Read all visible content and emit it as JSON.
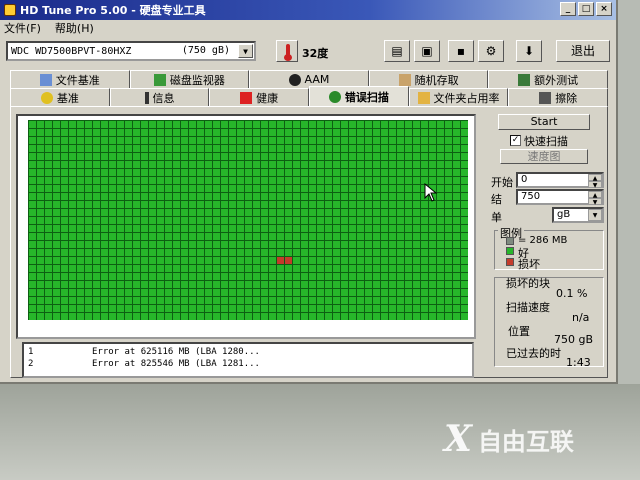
{
  "window": {
    "title": "HD Tune Pro 5.00 - 硬盘专业工具"
  },
  "menu": {
    "items": [
      "文件(F)",
      "帮助(H)"
    ]
  },
  "toolbar": {
    "drive_name": "WDC WD7500BPVT-80HXZ",
    "drive_capacity": "(750 gB)",
    "temperature": "32度",
    "exit_label": "退出",
    "icons": [
      "copy-info-icon",
      "copy-screenshot-icon",
      "save-icon",
      "options-icon",
      "down-arrow-icon"
    ]
  },
  "tabs_row1": [
    {
      "label": "文件基准",
      "icon": "file-benchmark-icon"
    },
    {
      "label": "磁盘监视器",
      "icon": "disk-monitor-icon"
    },
    {
      "label": "AAM",
      "icon": "aam-icon"
    },
    {
      "label": "随机存取",
      "icon": "random-access-icon"
    },
    {
      "label": "额外测试",
      "icon": "extra-tests-icon"
    }
  ],
  "tabs_row2": [
    {
      "label": "基准",
      "icon": "benchmark-icon",
      "active": false
    },
    {
      "label": "信息",
      "icon": "info-icon",
      "active": false
    },
    {
      "label": "健康",
      "icon": "health-icon",
      "active": false
    },
    {
      "label": "错误扫描",
      "icon": "error-scan-icon",
      "active": true
    },
    {
      "label": "文件夹占用率",
      "icon": "folder-usage-icon",
      "active": false
    },
    {
      "label": "擦除",
      "icon": "erase-icon",
      "active": false
    }
  ],
  "controls": {
    "start_label": "Start",
    "quick_scan_label": "快速扫描",
    "quick_scan_checked": true,
    "speed_map_label": "速度图",
    "start_field_label": "开始",
    "start_value": "0",
    "end_field_label": "结",
    "end_value": "750",
    "unit_label": "单",
    "unit_value": "gB"
  },
  "legend": {
    "title": "图例",
    "block_size": "= 286 MB",
    "good_label": "好",
    "bad_label": "损坏"
  },
  "stats": {
    "damaged_label": "损坏的块",
    "damaged_value": "0.1 %",
    "speed_label": "扫描速度",
    "speed_value": "n/a",
    "position_label": "位置",
    "position_value": "750 gB",
    "elapsed_label": "已过去的时",
    "elapsed_value": "1:43"
  },
  "error_log": [
    {
      "num": "1",
      "text": "Error at 625116 MB (LBA 1280..."
    },
    {
      "num": "2",
      "text": "Error at 825546 MB (LBA 1281..."
    }
  ],
  "scan_grid": {
    "bad_blocks": [
      2,
      3
    ],
    "bad_row": 17
  },
  "colors": {
    "good": "#27b62a",
    "bad": "#c43b2b",
    "grid_line": "#0d5f12",
    "gray": "#7f8a7f"
  },
  "watermark": {
    "logo": "X",
    "text": "自由互联"
  }
}
